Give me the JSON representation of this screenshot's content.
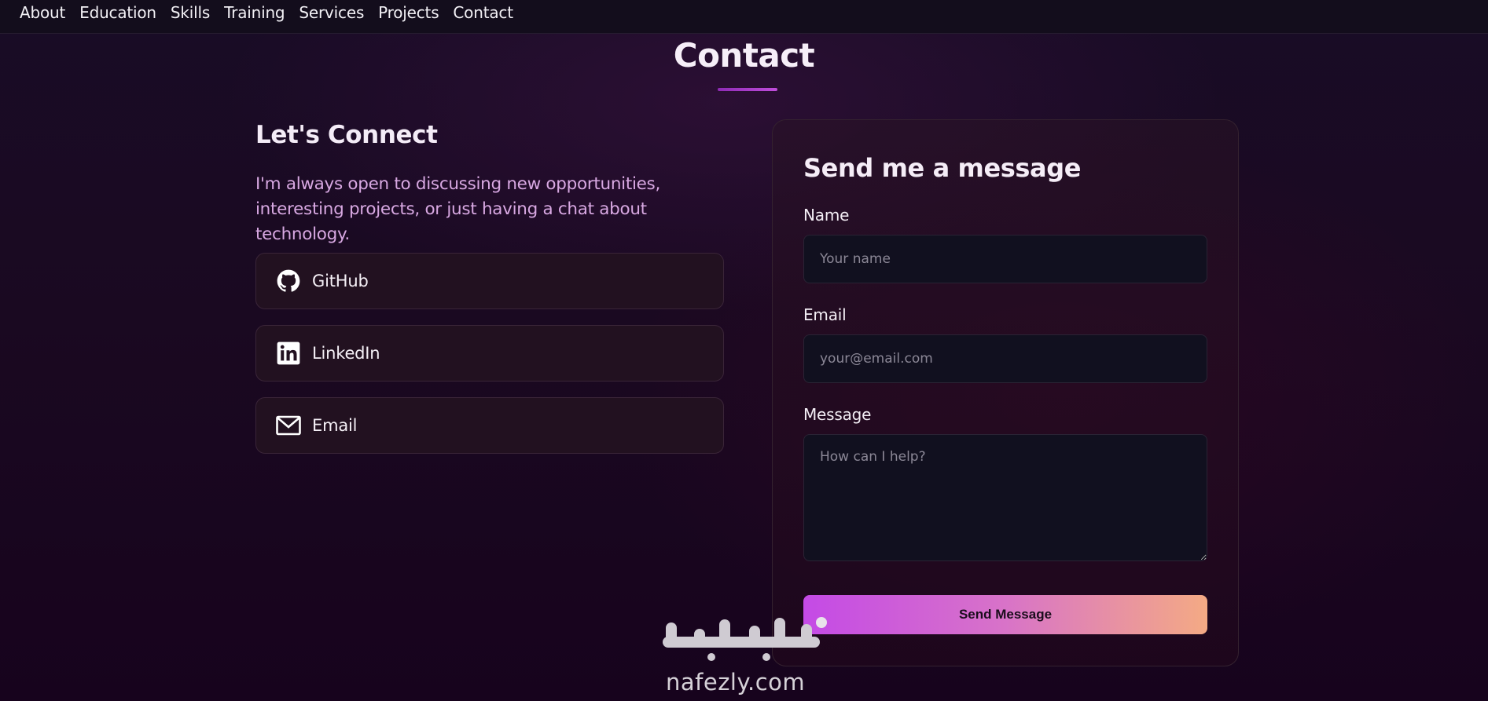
{
  "nav": {
    "items": [
      "About",
      "Education",
      "Skills",
      "Training",
      "Services",
      "Projects",
      "Contact"
    ]
  },
  "section": {
    "title": "Contact"
  },
  "connect": {
    "heading": "Let's Connect",
    "text": "I'm always open to discussing new opportunities, interesting projects, or just having a chat about technology.",
    "links": [
      {
        "label": "GitHub",
        "icon": "github-icon"
      },
      {
        "label": "LinkedIn",
        "icon": "linkedin-icon"
      },
      {
        "label": "Email",
        "icon": "mail-icon"
      }
    ]
  },
  "form": {
    "title": "Send me a message",
    "name_label": "Name",
    "name_placeholder": "Your name",
    "email_label": "Email",
    "email_placeholder": "your@email.com",
    "message_label": "Message",
    "message_placeholder": "How can I help?",
    "submit_label": "Send Message"
  },
  "watermark": {
    "arabic": "نفذلي",
    "latin": "nafezly.com"
  },
  "colors": {
    "accent_start": "#c44ae6",
    "accent_end": "#f4aa84",
    "subtext": "#d8a8e2"
  }
}
